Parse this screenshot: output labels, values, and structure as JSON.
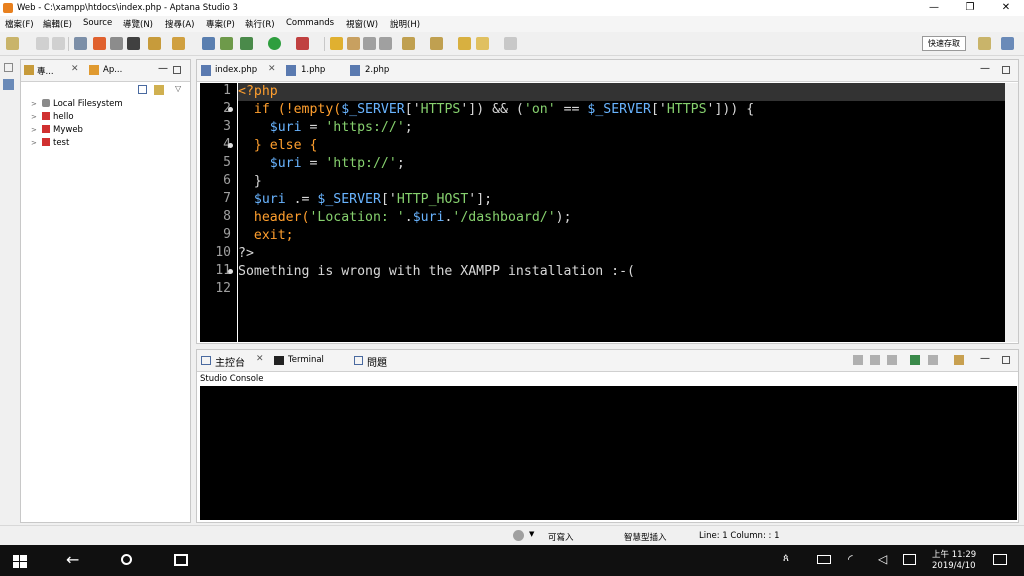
{
  "window": {
    "title": "Web - C:\\xampp\\htdocs\\index.php - Aptana Studio 3",
    "minimize": "—",
    "maximize": "❐",
    "close": "✕"
  },
  "menu": [
    "檔案(F)",
    "編輯(E)",
    "Source",
    "導覽(N)",
    "搜尋(A)",
    "專案(P)",
    "執行(R)",
    "Commands",
    "視窗(W)",
    "說明(H)"
  ],
  "quick_access": "快速存取",
  "explorer": {
    "tabs": [
      "專...",
      "Ap..."
    ],
    "items": [
      {
        "label": "Local Filesystem",
        "icon": "drive-icon"
      },
      {
        "label": "hello",
        "icon": "project-icon"
      },
      {
        "label": "Myweb",
        "icon": "project-icon"
      },
      {
        "label": "test",
        "icon": "project-icon"
      }
    ]
  },
  "editor": {
    "tabs": [
      "index.php",
      "1.php",
      "2.php"
    ],
    "line_numbers": [
      "1",
      "2",
      "3",
      "4",
      "5",
      "6",
      "7",
      "8",
      "9",
      "10",
      "11",
      "12"
    ],
    "lines": [
      [
        {
          "t": "<?php",
          "c": "kw"
        }
      ],
      [
        {
          "t": "  if (!empty(",
          "c": "kw"
        },
        {
          "t": "$_SERVER",
          "c": "v"
        },
        {
          "t": "['",
          "c": "op"
        },
        {
          "t": "HTTPS",
          "c": "s"
        },
        {
          "t": "']) && (",
          "c": "op"
        },
        {
          "t": "'on'",
          "c": "s"
        },
        {
          "t": " == ",
          "c": "op"
        },
        {
          "t": "$_SERVER",
          "c": "v"
        },
        {
          "t": "['",
          "c": "op"
        },
        {
          "t": "HTTPS",
          "c": "s"
        },
        {
          "t": "'])) {",
          "c": "op"
        }
      ],
      [
        {
          "t": "    $uri",
          "c": "v"
        },
        {
          "t": " = ",
          "c": "op"
        },
        {
          "t": "'https://'",
          "c": "s"
        },
        {
          "t": ";",
          "c": "op"
        }
      ],
      [
        {
          "t": "  } else {",
          "c": "kw"
        }
      ],
      [
        {
          "t": "    $uri",
          "c": "v"
        },
        {
          "t": " = ",
          "c": "op"
        },
        {
          "t": "'http://'",
          "c": "s"
        },
        {
          "t": ";",
          "c": "op"
        }
      ],
      [
        {
          "t": "  }",
          "c": "op"
        }
      ],
      [
        {
          "t": "  $uri",
          "c": "v"
        },
        {
          "t": " .= ",
          "c": "op"
        },
        {
          "t": "$_SERVER",
          "c": "v"
        },
        {
          "t": "['",
          "c": "op"
        },
        {
          "t": "HTTP_HOST",
          "c": "s"
        },
        {
          "t": "'];",
          "c": "op"
        }
      ],
      [
        {
          "t": "  header(",
          "c": "kw"
        },
        {
          "t": "'Location: '",
          "c": "s"
        },
        {
          "t": ".",
          "c": "op"
        },
        {
          "t": "$uri",
          "c": "v"
        },
        {
          "t": ".",
          "c": "op"
        },
        {
          "t": "'/dashboard/'",
          "c": "s"
        },
        {
          "t": ");",
          "c": "op"
        }
      ],
      [
        {
          "t": "  exit;",
          "c": "kw"
        }
      ],
      [
        {
          "t": "?>",
          "c": "op"
        }
      ],
      [
        {
          "t": "Something is wrong with the XAMPP installation :-(",
          "c": "op"
        }
      ],
      [
        {
          "t": "",
          "c": "op"
        }
      ]
    ]
  },
  "console": {
    "tabs": [
      "主控台",
      "Terminal",
      "問題"
    ],
    "label": "Studio Console"
  },
  "status": {
    "mode": "可寫入",
    "insert": "智慧型插入",
    "position": "Line: 1 Column: : 1"
  },
  "taskbar": {
    "time": "上午 11:29",
    "date": "2019/4/10"
  },
  "colors": {
    "keyword": "#ff9f2e",
    "variable": "#69b4ff",
    "string": "#86d06e",
    "editor_bg": "#000000"
  }
}
